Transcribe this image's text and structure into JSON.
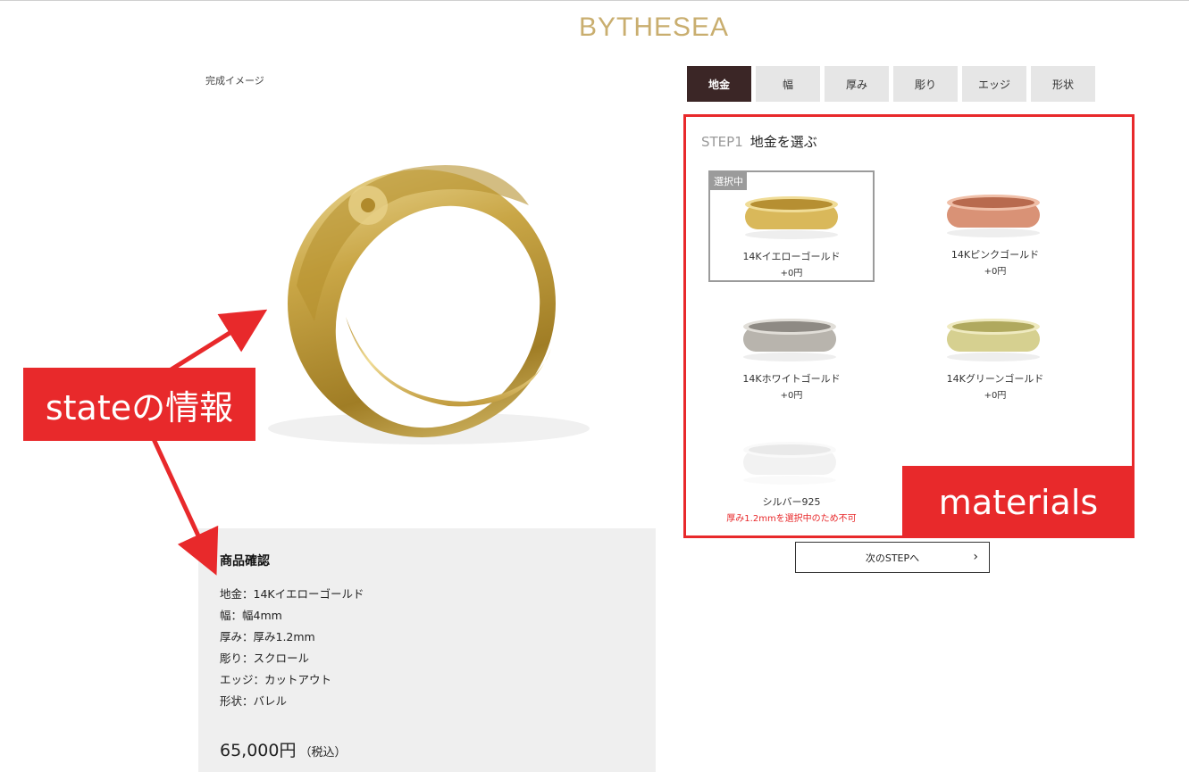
{
  "logo": {
    "text": "BYTHESEA"
  },
  "preview": {
    "caption": "完成イメージ"
  },
  "tabs": [
    {
      "label": "地金",
      "active": true
    },
    {
      "label": "幅",
      "active": false
    },
    {
      "label": "厚み",
      "active": false
    },
    {
      "label": "彫り",
      "active": false
    },
    {
      "label": "エッジ",
      "active": false
    },
    {
      "label": "形状",
      "active": false
    }
  ],
  "step": {
    "number": "STEP1",
    "title": "地金を選ぶ"
  },
  "options": [
    {
      "name": "14Kイエローゴールド",
      "price": "+0円",
      "badge": "選択中",
      "color": "#d9b85a",
      "selected": true
    },
    {
      "name": "14Kピンクゴールド",
      "price": "+0円",
      "color": "#d99276",
      "selected": false
    },
    {
      "name": "14Kホワイトゴールド",
      "price": "+0円",
      "color": "#b8b4ad",
      "selected": false
    },
    {
      "name": "14Kグリーンゴールド",
      "price": "+0円",
      "color": "#d6d090",
      "selected": false
    },
    {
      "name": "シルバー925",
      "warning": "厚み1.2mmを選択中のため不可",
      "color": "#cfcfcf",
      "selected": false,
      "disabled": true
    }
  ],
  "next_button": {
    "label": "次のSTEPへ",
    "icon": "chevron-right-icon"
  },
  "confirm": {
    "title": "商品確認",
    "specs": [
      "地金：14Kイエローゴールド",
      "幅：幅4mm",
      "厚み：厚み1.2mm",
      "彫り：スクロール",
      "エッジ：カットアウト",
      "形状：バレル"
    ],
    "price": "65,000円",
    "tax_note": "（税込）"
  },
  "annotations": {
    "state": "stateの情報",
    "materials": "materials",
    "color": "#e8292b"
  }
}
